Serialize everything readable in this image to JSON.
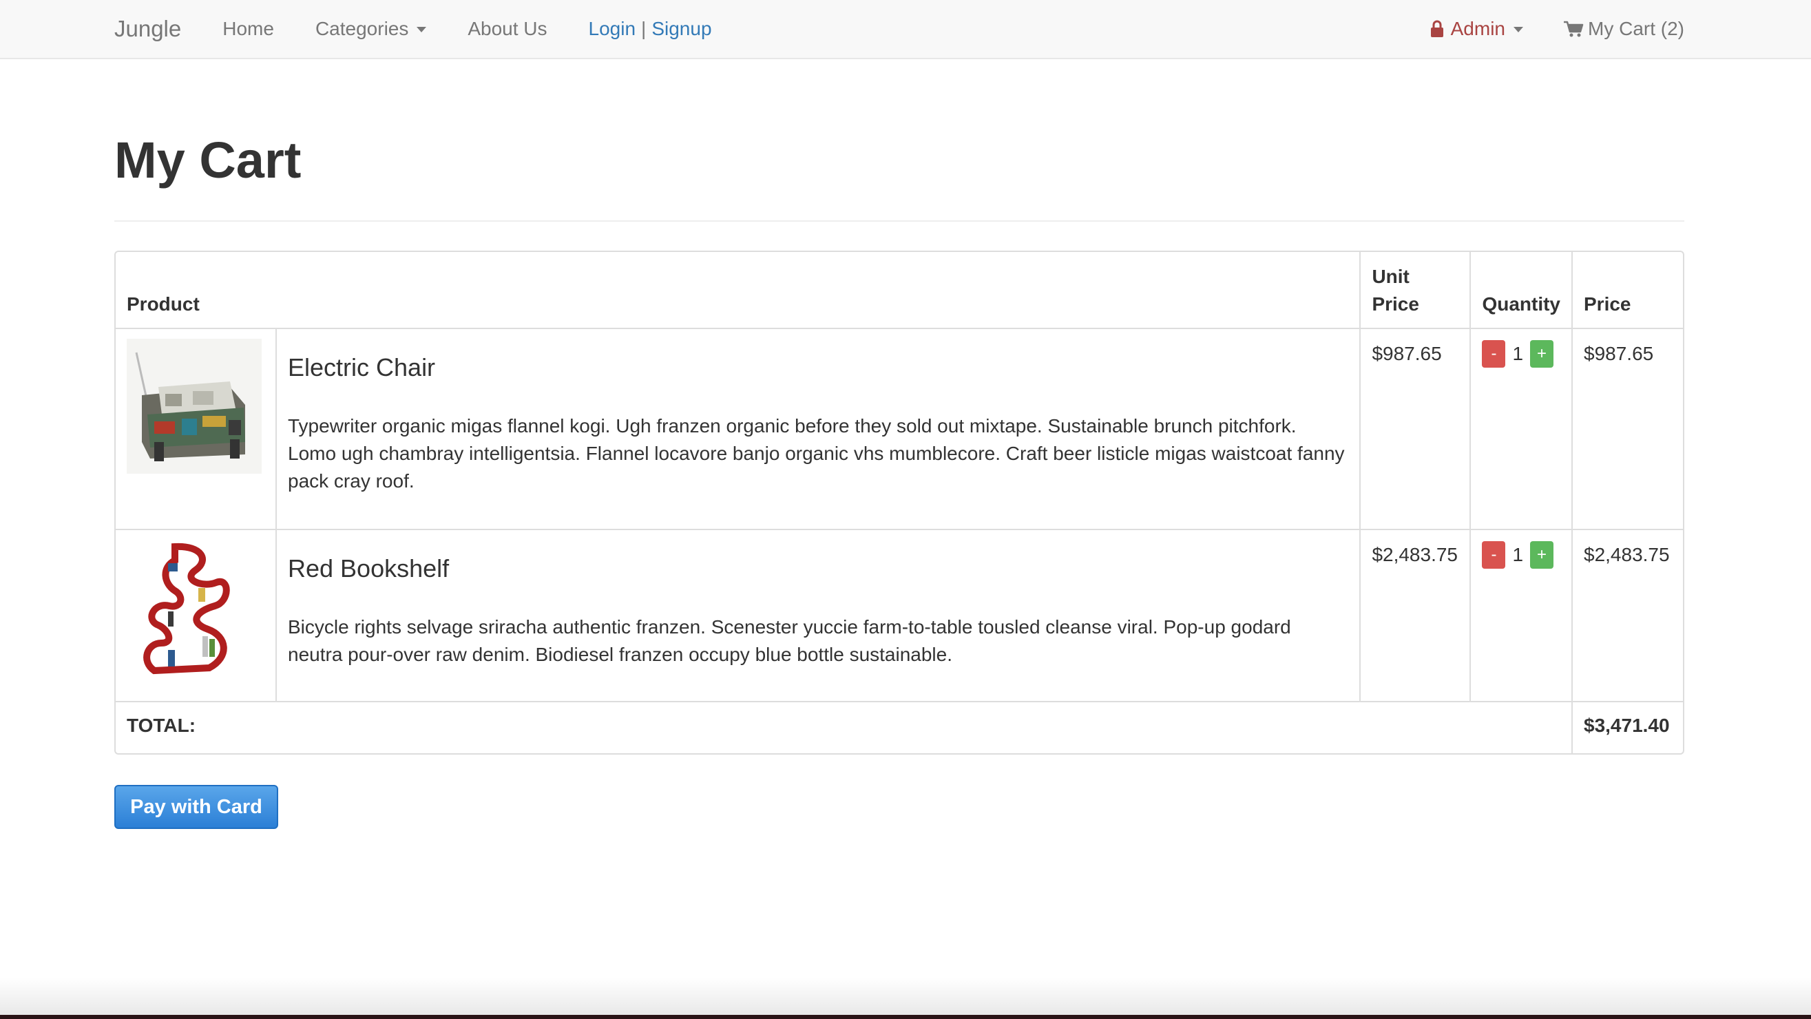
{
  "navbar": {
    "brand": "Jungle",
    "home": "Home",
    "categories": "Categories",
    "about": "About Us",
    "login": "Login",
    "separator": "|",
    "signup": "Signup",
    "admin": "Admin",
    "cart": "My Cart (2)"
  },
  "page": {
    "title": "My Cart"
  },
  "table": {
    "headers": {
      "product": "Product",
      "unit_price_line1": "Unit",
      "unit_price_line2": "Price",
      "quantity": "Quantity",
      "price": "Price"
    },
    "items": [
      {
        "name": "Electric Chair",
        "description": "Typewriter organic migas flannel kogi. Ugh franzen organic before they sold out mixtape. Sustainable brunch pitchfork. Lomo ugh chambray intelligentsia. Flannel locavore banjo organic vhs mumblecore. Craft beer listicle migas waistcoat fanny pack cray roof.",
        "unit_price": "$987.65",
        "quantity": "1",
        "minus": "-",
        "plus": "+",
        "price": "$987.65"
      },
      {
        "name": "Red Bookshelf",
        "description": "Bicycle rights selvage sriracha authentic franzen. Scenester yuccie farm-to-table tousled cleanse viral. Pop-up godard neutra pour-over raw denim. Biodiesel franzen occupy blue bottle sustainable.",
        "unit_price": "$2,483.75",
        "quantity": "1",
        "minus": "-",
        "plus": "+",
        "price": "$2,483.75"
      }
    ],
    "total_label": "TOTAL:",
    "total_value": "$3,471.40"
  },
  "pay_button": "Pay with Card",
  "icons": {
    "lock": "lock-icon",
    "cart": "shopping-cart-icon",
    "caret": "caret-down-icon"
  },
  "colors": {
    "link": "#337ab7",
    "admin": "#a94442",
    "minus_button": "#d9534f",
    "plus_button": "#5cb85c",
    "pay_button": "#2b7fd6"
  }
}
